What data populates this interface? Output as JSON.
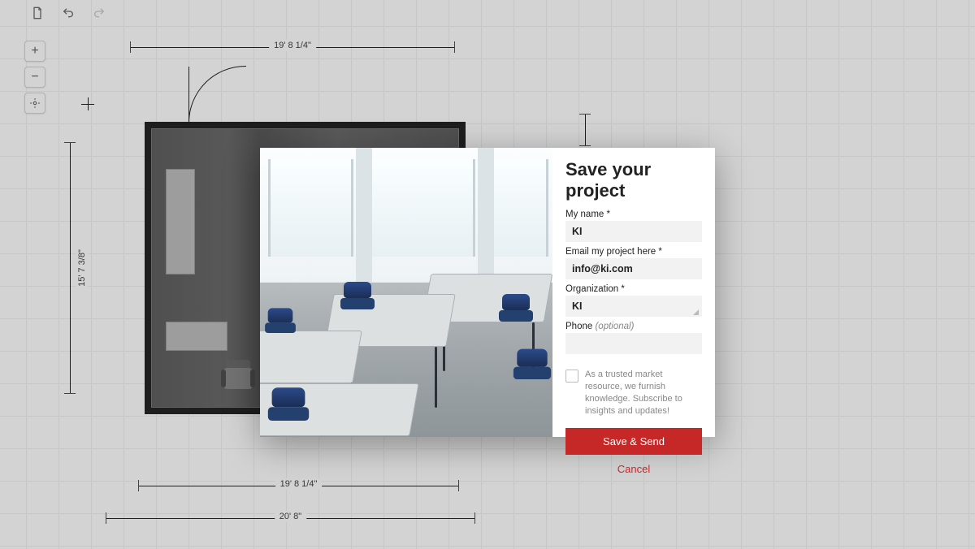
{
  "toolbar": {
    "icons": {
      "newFile": "new-file-icon",
      "undo": "undo-icon",
      "redo": "redo-icon"
    }
  },
  "zoom": {
    "in": "+",
    "out": "−",
    "center": "⊕"
  },
  "dimensions": {
    "top_width": "19' 8 1/4\"",
    "left_height": "15' 7 3/8\"",
    "bottom_inner": "19' 8 1/4\"",
    "bottom_outer": "20' 8\""
  },
  "modal": {
    "title": "Save your project",
    "fields": {
      "name_label": "My name *",
      "name_value": "KI",
      "email_label": "Email my project here *",
      "email_value": "info@ki.com",
      "org_label": "Organization *",
      "org_value": "KI",
      "phone_label": "Phone",
      "phone_optional": "(optional)",
      "phone_value": ""
    },
    "subscribe_text": "As a trusted market resource, we furnish knowledge. Subscribe to insights and updates!",
    "primary_button": "Save & Send",
    "cancel_button": "Cancel"
  },
  "colors": {
    "accent": "#c62828"
  }
}
